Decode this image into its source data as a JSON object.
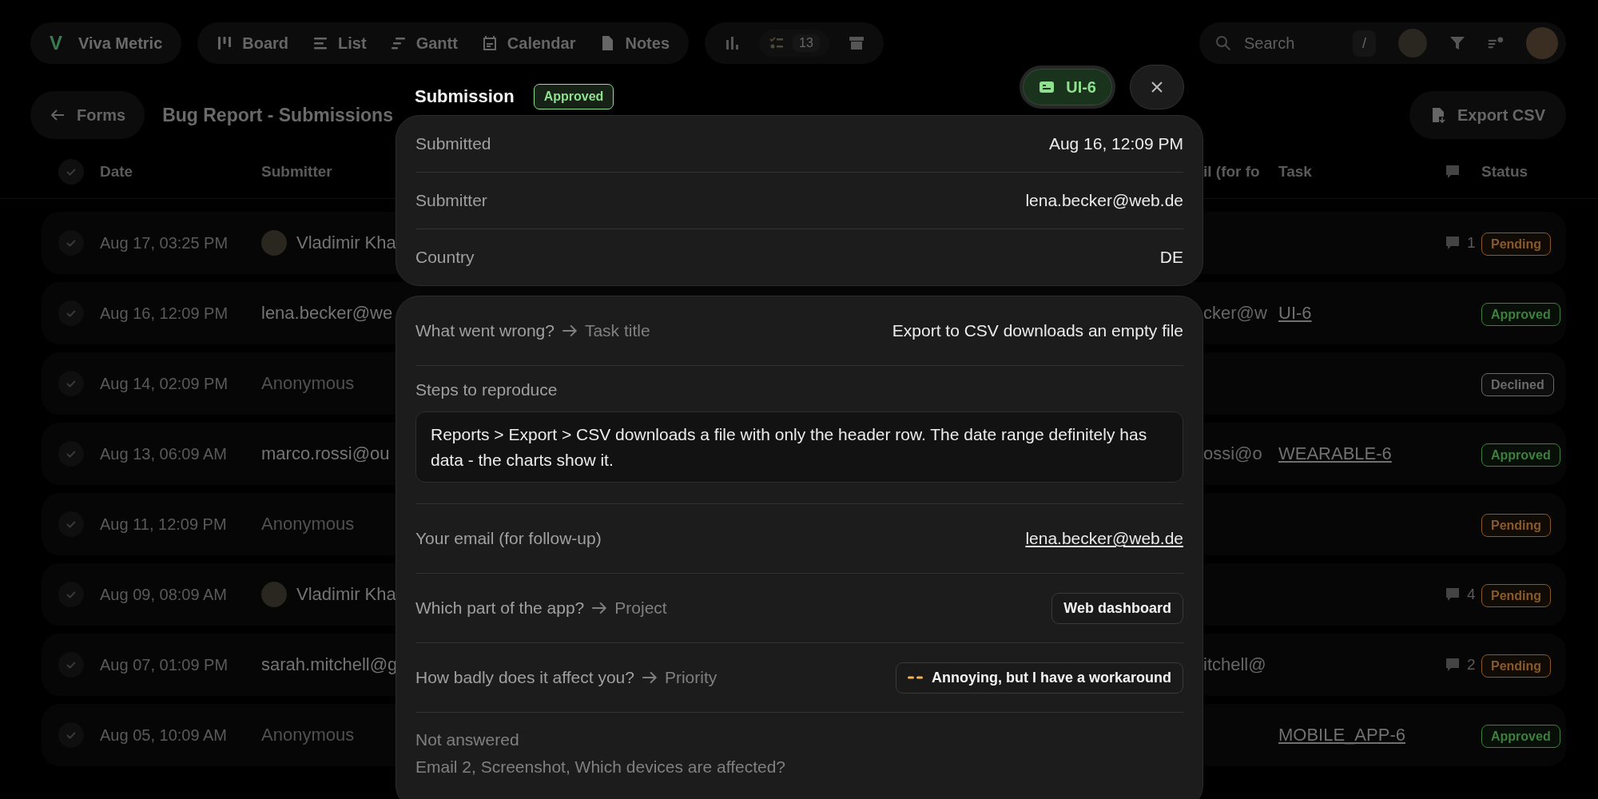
{
  "app": {
    "logo_letter": "V",
    "name": "Viva Metric"
  },
  "views": [
    {
      "kind": "board",
      "label": "Board",
      "selected": false
    },
    {
      "kind": "list",
      "label": "List",
      "selected": false
    },
    {
      "kind": "gantt",
      "label": "Gantt",
      "selected": false
    },
    {
      "kind": "calendar",
      "label": "Calendar",
      "selected": false
    },
    {
      "kind": "notes",
      "label": "Notes",
      "selected": false
    }
  ],
  "tools": {
    "tasks_count": "13"
  },
  "search": {
    "placeholder": "Search",
    "shortcut": "/"
  },
  "back_button": "Forms",
  "page_title": "Bug Report - Submissions",
  "export_button": "Export CSV",
  "table": {
    "select_all_checked": false,
    "columns": {
      "date": "Date",
      "submitter": "Submitter",
      "email": "il (for fo",
      "task": "Task",
      "status": "Status"
    },
    "rows": [
      {
        "checked": false,
        "date": "Aug 17, 03:25 PM",
        "submitter": "Vladimir Kha",
        "avatar": true,
        "anonymous": false,
        "comments": "1",
        "status": "Pending",
        "color": "#8a5a2a"
      },
      {
        "checked": false,
        "date": "Aug 16, 12:09 PM",
        "submitter": "lena.becker@we",
        "avatar": false,
        "anonymous": false,
        "email": "cker@w",
        "task": "UI-6",
        "status": "Approved",
        "color": "#3f7f3f"
      },
      {
        "checked": false,
        "date": "Aug 14, 02:09 PM",
        "submitter": "Anonymous",
        "avatar": false,
        "anonymous": true,
        "status": "Declined",
        "color": "#6a6a6a"
      },
      {
        "checked": false,
        "date": "Aug 13, 06:09 AM",
        "submitter": "marco.rossi@ou",
        "avatar": false,
        "anonymous": false,
        "email": "ossi@o",
        "task": "WEARABLE-6",
        "status": "Approved",
        "color": "#3f7f3f"
      },
      {
        "checked": false,
        "date": "Aug 11, 12:09 PM",
        "submitter": "Anonymous",
        "avatar": false,
        "anonymous": true,
        "status": "Pending",
        "color": "#8a5a2a"
      },
      {
        "checked": false,
        "date": "Aug 09, 08:09 AM",
        "submitter": "Vladimir Kha",
        "avatar": true,
        "anonymous": false,
        "comments": "4",
        "status": "Pending",
        "color": "#8a5a2a"
      },
      {
        "checked": false,
        "date": "Aug 07, 01:09 PM",
        "submitter": "sarah.mitchell@g",
        "avatar": false,
        "anonymous": false,
        "email": "itchell@",
        "comments": "2",
        "status": "Pending",
        "color": "#8a5a2a"
      },
      {
        "checked": false,
        "date": "Aug 05, 10:09 AM",
        "submitter": "Anonymous",
        "avatar": false,
        "anonymous": true,
        "task": "MOBILE_APP-6",
        "status": "Approved",
        "color": "#3f7f3f"
      }
    ]
  },
  "modal": {
    "title": "Submission",
    "status": "Approved",
    "color": "#8fe08f",
    "task_button": "UI-6",
    "meta": [
      {
        "label": "Submitted",
        "value": "Aug 16, 12:09 PM"
      },
      {
        "label": "Submitter",
        "value": "lena.becker@web.de"
      },
      {
        "label": "Country",
        "value": "DE"
      }
    ],
    "answers": [
      {
        "kind": "text",
        "question": "What went wrong?",
        "mapping": "Task title",
        "value": "Export to CSV downloads an empty file"
      },
      {
        "kind": "block",
        "question": "Steps to reproduce",
        "value": "Reports > Export > CSV downloads a file with only the header row. The date range definitely has data - the charts show it."
      },
      {
        "kind": "link",
        "question": "Your email (for follow-up)",
        "value": "lena.becker@web.de"
      },
      {
        "kind": "tag",
        "question": "Which part of the app?",
        "mapping": "Project",
        "value": "Web dashboard"
      },
      {
        "kind": "priority",
        "question": "How badly does it affect you?",
        "mapping": "Priority",
        "value": "Annoying, but I have a workaround",
        "color": "#f5b350"
      }
    ],
    "not_answered": {
      "label": "Not answered",
      "fields": "Email 2, Screenshot, Which devices are affected?"
    }
  }
}
